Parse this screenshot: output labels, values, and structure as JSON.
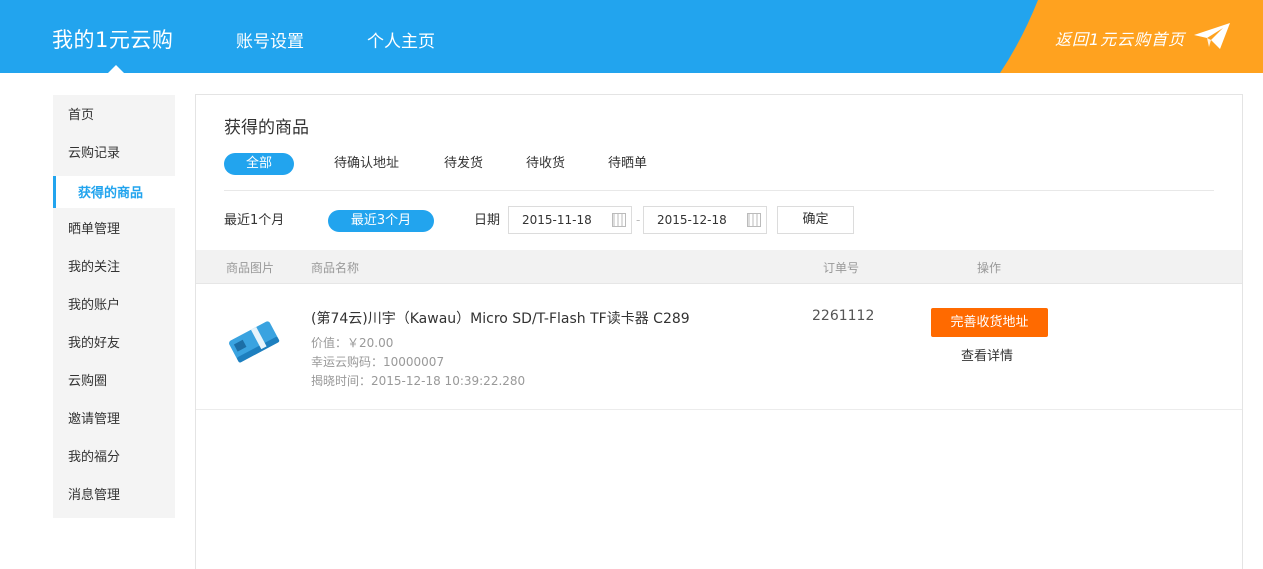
{
  "header": {
    "brand": "我的1元云购",
    "nav": [
      "账号设置",
      "个人主页"
    ],
    "back_link": "返回1元云购首页",
    "colors": {
      "primary": "#22a4ee",
      "accent": "#ffa21f"
    }
  },
  "sidebar": {
    "items": [
      "首页",
      "云购记录",
      "获得的商品",
      "晒单管理",
      "我的关注",
      "我的账户",
      "我的好友",
      "云购圈",
      "邀请管理",
      "我的福分",
      "消息管理"
    ],
    "active": "获得的商品"
  },
  "main": {
    "title": "获得的商品",
    "tabs": [
      "全部",
      "待确认地址",
      "待发货",
      "待收货",
      "待晒单"
    ],
    "active_tab": "全部",
    "filters": {
      "range_options": [
        "最近1个月",
        "最近3个月"
      ],
      "active_range": "最近3个月",
      "date_label": "日期",
      "start_date": "2015-11-18",
      "end_date": "2015-12-18",
      "separator": "-",
      "confirm_label": "确定"
    },
    "table": {
      "columns": [
        "商品图片",
        "商品名称",
        "订单号",
        "操作"
      ],
      "rows": [
        {
          "name": "(第74云)川宇（Kawau）Micro SD/T-Flash TF读卡器 C289",
          "price": "价值：￥20.00",
          "lucky_code": "幸运云购码：10000007",
          "reveal_time": "揭晓时间：2015-12-18 10:39:22.280",
          "order_no": "2261112",
          "action_primary": "完善收货地址",
          "action_secondary": "查看详情"
        }
      ]
    }
  }
}
